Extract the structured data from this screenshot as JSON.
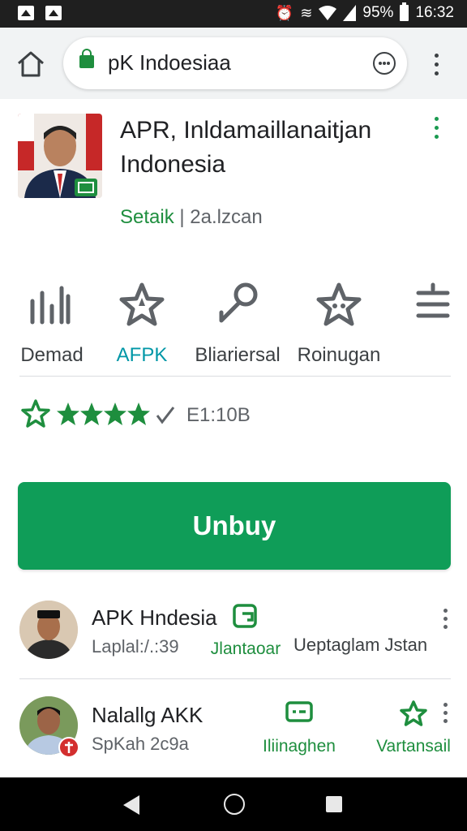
{
  "status_bar": {
    "battery_text": "95%",
    "time": "16:32"
  },
  "browser": {
    "url": "pK Indoesiaa"
  },
  "app": {
    "title": "APR, Inldamaillanaitjan Indonesia",
    "developer": "Setaik",
    "separator": "|",
    "category": "2a.lzcan"
  },
  "actions": [
    {
      "label": "Demad",
      "icon": "bar-chart-icon"
    },
    {
      "label": "AFPK",
      "icon": "star-icon"
    },
    {
      "label": "Bliariersal",
      "icon": "link-icon"
    },
    {
      "label": "Roinugan",
      "icon": "star-badge-icon"
    },
    {
      "label": "",
      "icon": "menu-lines-icon"
    }
  ],
  "rating": {
    "stars": 5,
    "value_text": "E1:10B"
  },
  "install": {
    "label": "Unbuy"
  },
  "list": [
    {
      "title": "APK Hndesia",
      "subtitle": "Laplal:/.:39",
      "action1": "Jlantaoar",
      "action2": "Ueptaglam Jstan"
    },
    {
      "title": "Nalallg AKK",
      "subtitle": "SpKah 2c9a",
      "action1": "Iliinaghen",
      "action2": "Vartansail"
    }
  ],
  "colors": {
    "accent_green": "#0f9d58",
    "text_green": "#1e8e3e",
    "active_tab": "#0097a7"
  }
}
